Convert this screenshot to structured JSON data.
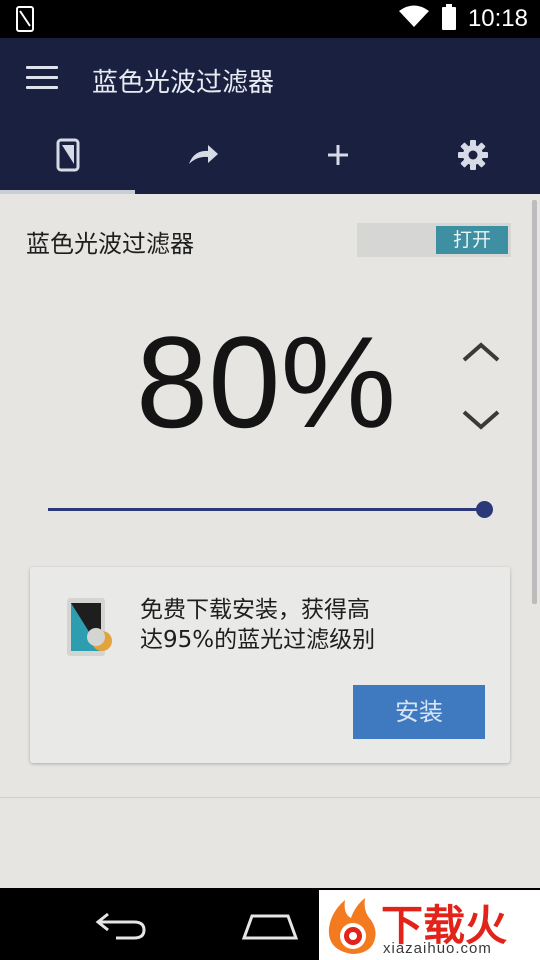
{
  "status_bar": {
    "time": "10:18",
    "icons": [
      "screen-filter-icon",
      "wifi-icon",
      "battery-icon"
    ]
  },
  "toolbar": {
    "title": "蓝色光波过滤器",
    "menu_icon": "hamburger-menu-icon"
  },
  "tabs": [
    {
      "icon": "phone-filter-icon",
      "active": true
    },
    {
      "icon": "redo-arrow-icon",
      "active": false
    },
    {
      "icon": "plus-icon",
      "active": false
    },
    {
      "icon": "gear-icon",
      "active": false
    }
  ],
  "filter": {
    "label": "蓝色光波过滤器",
    "toggle_label": "打开",
    "percent_text": "80%",
    "level": 100
  },
  "promo": {
    "text_line1": "免费下载安装，获得高",
    "text_line2": "达95%的蓝光过滤级别",
    "install_label": "安装"
  },
  "watermark": {
    "brand": "下载火",
    "domain": "xiazaihuo.com"
  },
  "colors": {
    "toolbar": "#1a2140",
    "background": "#e6e5e2",
    "accent": "#2c3978",
    "toggle_on": "#3d8fa1",
    "install_button": "#3f79bf"
  }
}
